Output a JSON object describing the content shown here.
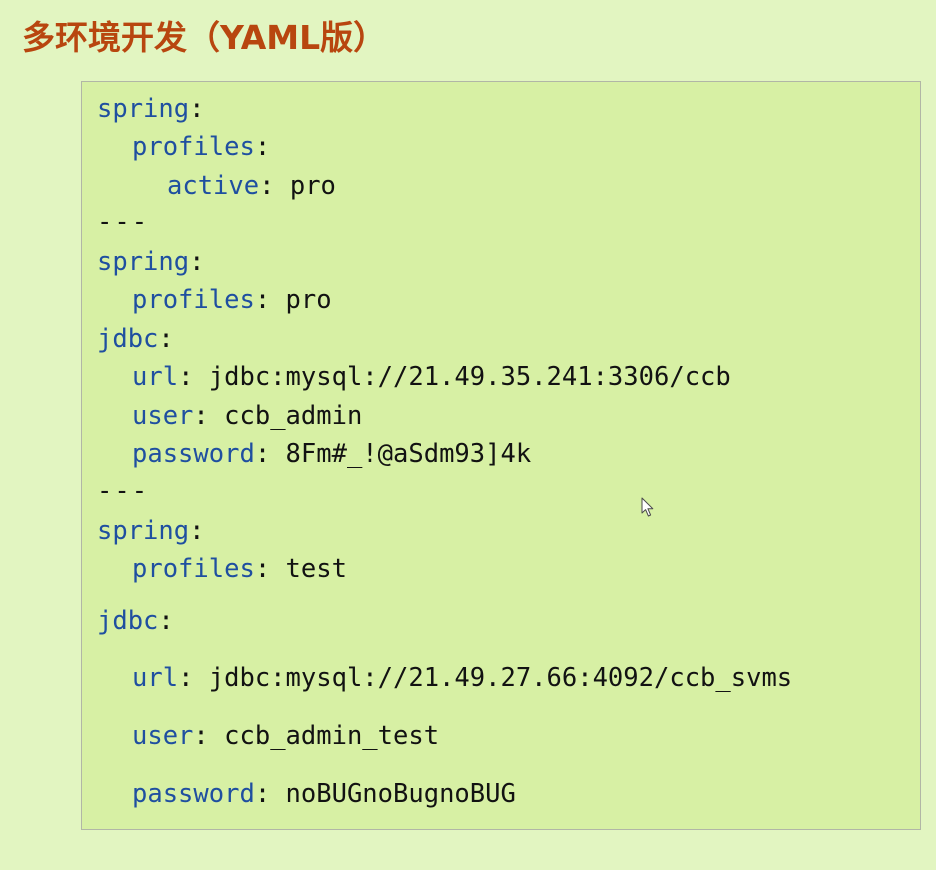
{
  "slide": {
    "title": "多环境开发（YAML版）"
  },
  "code": {
    "lines": [
      {
        "key": "spring",
        "colon": ":",
        "value": ""
      },
      {
        "key": "profiles",
        "colon": ":",
        "value": ""
      },
      {
        "key": "active",
        "colon": ":",
        "value": " pro"
      },
      {
        "separator": "---"
      },
      {
        "key": "spring",
        "colon": ":",
        "value": ""
      },
      {
        "key": "profiles",
        "colon": ":",
        "value": " pro"
      },
      {
        "key": "jdbc",
        "colon": ":",
        "value": ""
      },
      {
        "key": "url",
        "colon": ":",
        "value": " jdbc:mysql://21.49.35.241:3306/ccb"
      },
      {
        "key": "user",
        "colon": ":",
        "value": " ccb_admin"
      },
      {
        "key": "password",
        "colon": ":",
        "value": " 8Fm#_!@aSdm93]4k"
      },
      {
        "separator": "---"
      },
      {
        "key": "spring",
        "colon": ":",
        "value": ""
      },
      {
        "key": "profiles",
        "colon": ":",
        "value": " test"
      },
      {
        "key": "jdbc",
        "colon": ":",
        "value": ""
      },
      {
        "key": "url",
        "colon": ":",
        "value": " jdbc:mysql://21.49.27.66:4092/ccb_svms"
      },
      {
        "key": "user",
        "colon": ":",
        "value": " ccb_admin_test"
      },
      {
        "key": "password",
        "colon": ":",
        "value": " noBUGnoBugnoBUG"
      }
    ]
  },
  "colors": {
    "background": "#e2f5c1",
    "panel": "#d7f0a4",
    "title": "#b8460f",
    "key": "#1f4fa0",
    "text": "#121212"
  },
  "icons": {
    "cursor": "mouse-pointer-icon"
  }
}
